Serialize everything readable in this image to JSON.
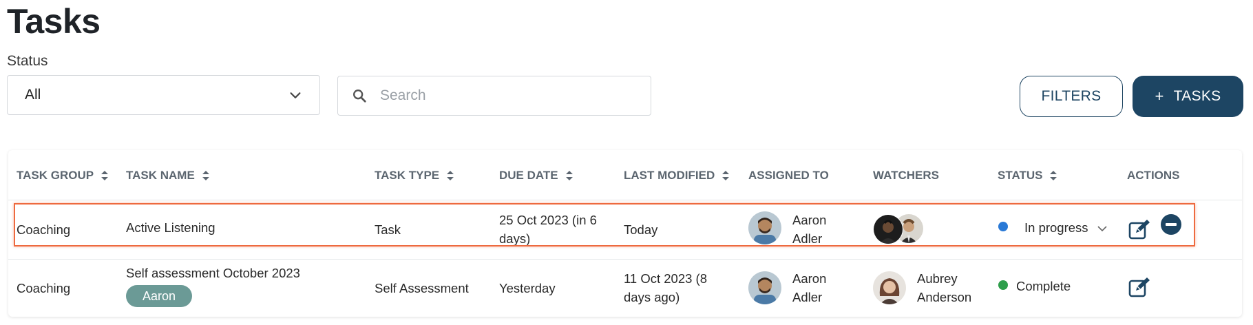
{
  "page": {
    "title": "Tasks"
  },
  "filters": {
    "status_label": "Status",
    "status_value": "All",
    "search_placeholder": "Search",
    "filters_button": "FILTERS",
    "add_tasks_button": "TASKS"
  },
  "table": {
    "columns": [
      "TASK GROUP",
      "TASK NAME",
      "TASK TYPE",
      "DUE DATE",
      "LAST MODIFIED",
      "ASSIGNED TO",
      "WATCHERS",
      "STATUS",
      "ACTIONS"
    ],
    "rows": [
      {
        "task_group": "Coaching",
        "task_name": "Active Listening",
        "task_type": "Task",
        "due_date_line1": "25 Oct 2023 (in 6",
        "due_date_line2": "days)",
        "last_modified": "Today",
        "assigned_first": "Aaron",
        "assigned_last": "Adler",
        "status": "In progress",
        "status_color": "#2979d6"
      },
      {
        "task_group": "Coaching",
        "task_name": "Self assessment October 2023",
        "task_tag": "Aaron",
        "task_type": "Self Assessment",
        "due_date": "Yesterday",
        "last_modified_line1": "11 Oct 2023 (8",
        "last_modified_line2": "days ago)",
        "assigned_first": "Aaron",
        "assigned_last": "Adler",
        "watcher_first": "Aubrey",
        "watcher_last": "Anderson",
        "status": "Complete",
        "status_color": "#2e9e4b"
      }
    ]
  },
  "colors": {
    "primary": "#1d4563",
    "highlight": "#ee6a3f",
    "tag": "#6b9a96"
  }
}
